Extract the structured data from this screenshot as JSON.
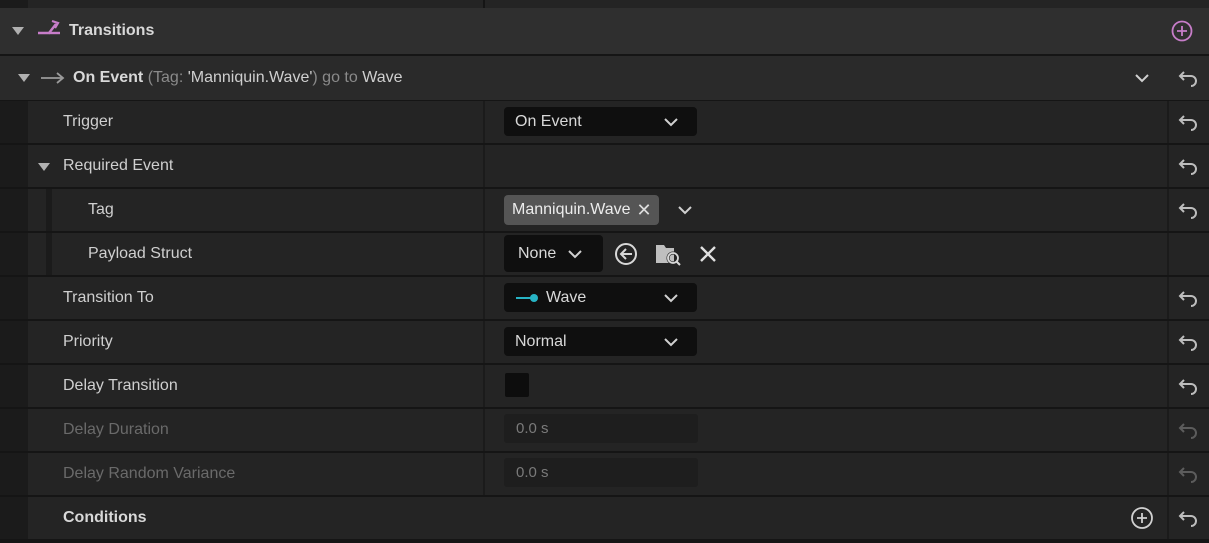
{
  "header": {
    "title": "Transitions"
  },
  "transition": {
    "prefix": "On Event",
    "paren": "(Tag: 'Manniquin.Wave')",
    "go_to": "go to",
    "target": "Wave"
  },
  "rows": {
    "trigger": {
      "label": "Trigger",
      "value": "On Event"
    },
    "required_event": {
      "label": "Required Event"
    },
    "tag": {
      "label": "Tag",
      "value": "Manniquin.Wave"
    },
    "payload": {
      "label": "Payload Struct",
      "value": "None"
    },
    "transition_to": {
      "label": "Transition To",
      "value": "Wave"
    },
    "priority": {
      "label": "Priority",
      "value": "Normal"
    },
    "delay_transition": {
      "label": "Delay Transition",
      "checked": false
    },
    "delay_duration": {
      "label": "Delay Duration",
      "value": "0.0 s"
    },
    "delay_variance": {
      "label": "Delay Random Variance",
      "value": "0.0 s"
    },
    "conditions": {
      "label": "Conditions"
    }
  },
  "colors": {
    "accent_pink": "#c77dc9",
    "state_link": "#27b3c4",
    "panel": "#242424"
  },
  "icons": {
    "header": "transition-icon",
    "collapse": "triangle-down-icon",
    "arrow": "arrow-right-icon",
    "add": "plus-circle-icon",
    "reset": "reset-arrow-icon",
    "browse": "use-selected-icon",
    "find": "browse-folder-icon",
    "clear": "clear-icon"
  }
}
